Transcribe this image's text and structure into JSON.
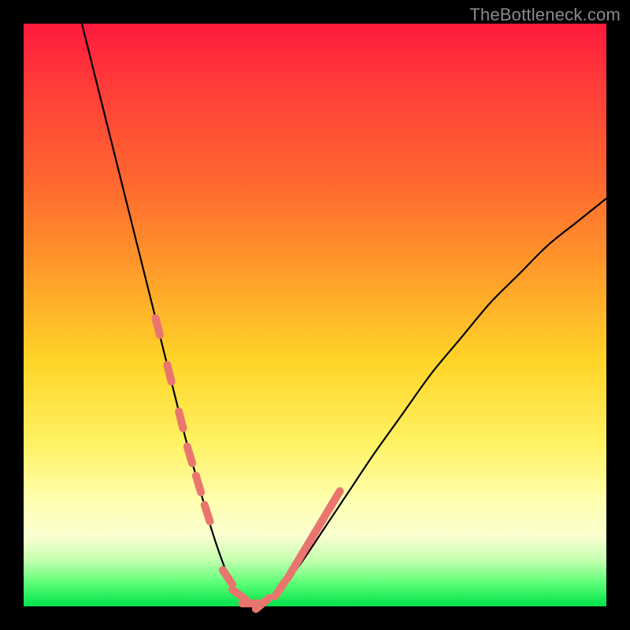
{
  "watermark": "TheBottleneck.com",
  "colors": {
    "background": "#000000",
    "curve": "#000000",
    "marker": "#e9766e"
  },
  "chart_data": {
    "type": "line",
    "title": "",
    "xlabel": "",
    "ylabel": "",
    "xlim": [
      0,
      100
    ],
    "ylim": [
      0,
      100
    ],
    "grid": false,
    "legend": false,
    "annotations": [
      "TheBottleneck.com"
    ],
    "note": "V-shaped bottleneck curve. x is an unlabeled parameter (0–100); y is bottleneck percentage (0 at valley, 100 at top). Left branch descends steeply from ~x=10,y=100 to the valley; right branch rises more gently toward ~x=100,y=70. Valley floor is flat near y=0 around x≈35–42.",
    "series": [
      {
        "name": "bottleneck-curve",
        "x": [
          10,
          15,
          20,
          23,
          26,
          28,
          30,
          32,
          34,
          36,
          38,
          40,
          42,
          45,
          48,
          52,
          56,
          60,
          65,
          70,
          75,
          80,
          85,
          90,
          95,
          100
        ],
        "y": [
          100,
          80,
          60,
          48,
          36,
          28,
          21,
          14,
          8,
          3,
          1,
          0,
          1,
          4,
          8,
          14,
          20,
          26,
          33,
          40,
          46,
          52,
          57,
          62,
          66,
          70
        ]
      }
    ],
    "markers": {
      "name": "highlight-dashes",
      "note": "Short salmon tick segments along the curve near the valley on both branches.",
      "x": [
        23,
        25,
        27,
        28.5,
        30,
        31.5,
        35,
        37,
        39,
        41,
        44,
        46,
        47.5,
        49,
        50.5,
        52,
        53.5
      ],
      "y": [
        48,
        40,
        32,
        26,
        21,
        16,
        5,
        2,
        0.5,
        0.5,
        3,
        6,
        8.5,
        11,
        13.5,
        16,
        18.5
      ]
    }
  }
}
